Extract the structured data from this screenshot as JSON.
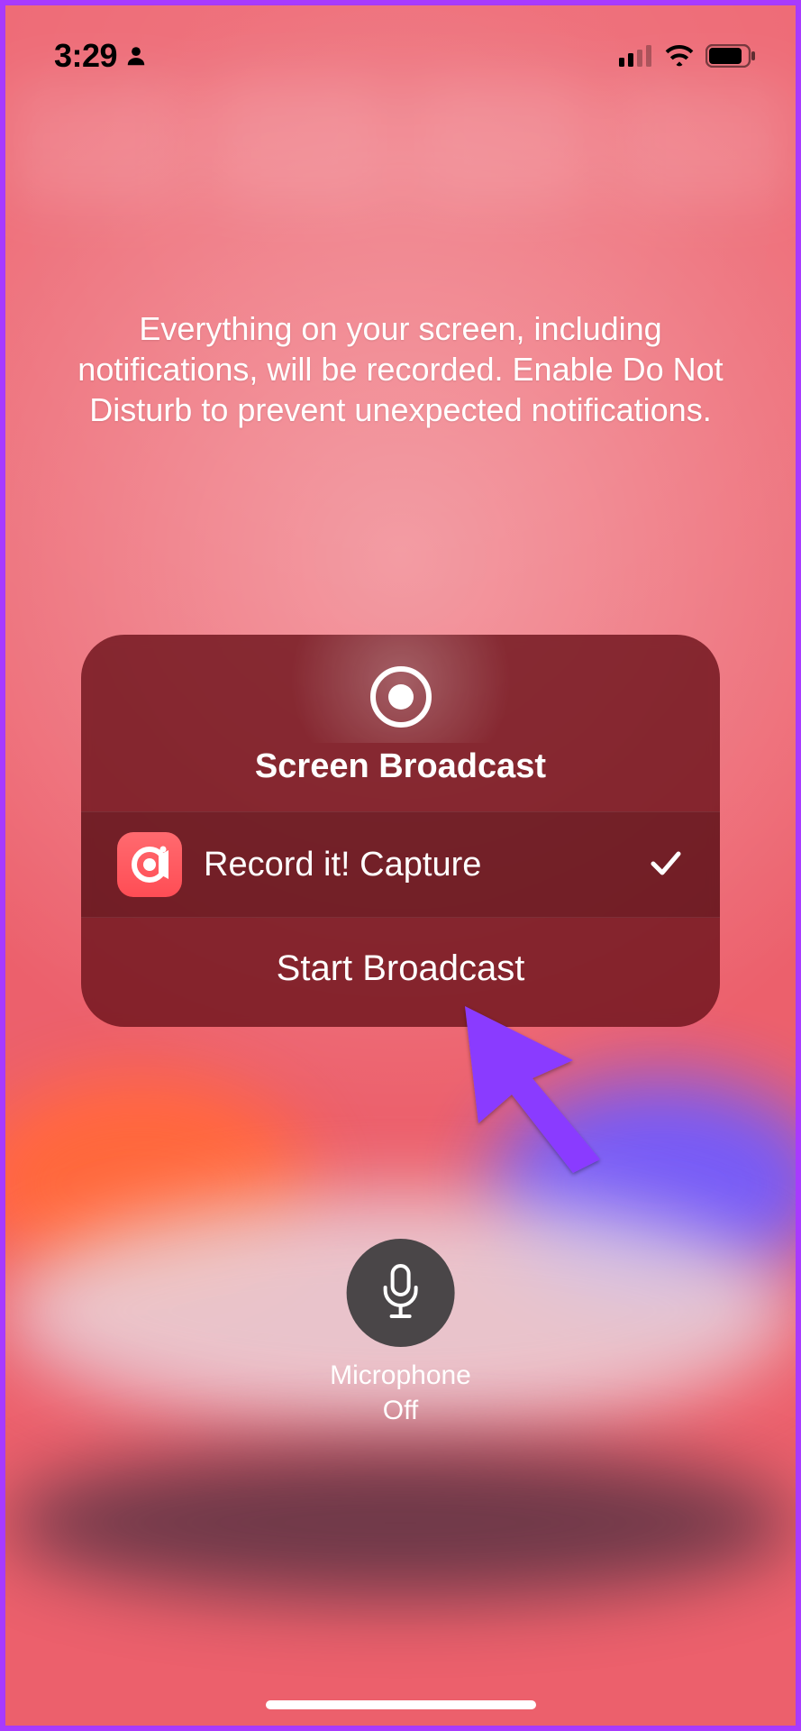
{
  "status": {
    "time": "3:29",
    "person_icon": "person-icon",
    "cellular_icon": "cellular-icon",
    "wifi_icon": "wifi-icon",
    "battery_icon": "battery-icon"
  },
  "instruction_text": "Everything on your screen, including notifications, will be recorded. Enable Do Not Disturb to prevent unexpected notifications.",
  "card": {
    "title": "Screen Broadcast",
    "selected_app": "Record it! Capture",
    "action_label": "Start Broadcast"
  },
  "microphone": {
    "label": "Microphone",
    "state": "Off"
  },
  "colors": {
    "accent_purple": "#8a3bff",
    "card_bg": "#6e141c",
    "app_icon_bg": "#ff5a60"
  }
}
